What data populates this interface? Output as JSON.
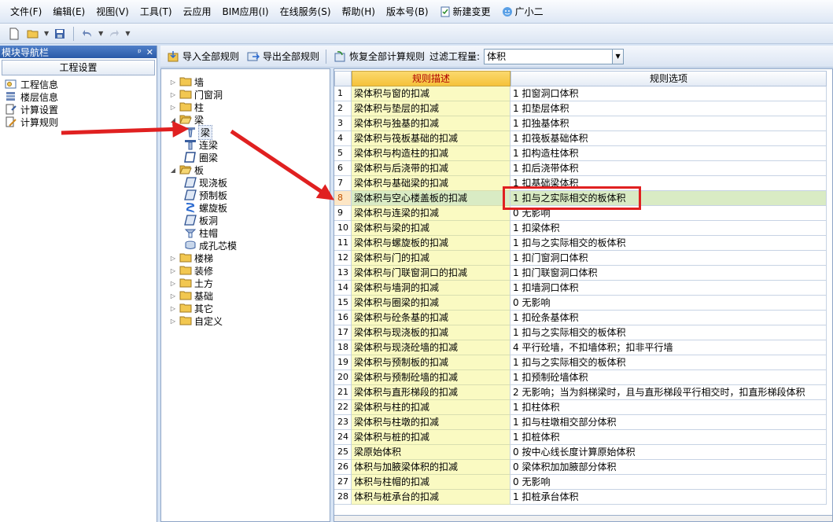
{
  "menu": {
    "items": [
      "文件(F)",
      "编辑(E)",
      "视图(V)",
      "工具(T)",
      "云应用",
      "BIM应用(I)",
      "在线服务(S)",
      "帮助(H)",
      "版本号(B)"
    ],
    "new_change": "新建变更",
    "assistant": "广小二"
  },
  "nav": {
    "title": "模块导航栏",
    "pin_icon": "ᵖ",
    "close_icon": "✕",
    "header": "工程设置",
    "items": [
      "工程信息",
      "楼层信息",
      "计算设置",
      "计算规则"
    ]
  },
  "right_toolbar": {
    "import_label": "导入全部规则",
    "export_label": "导出全部规则",
    "restore_label": "恢复全部计算规则",
    "filter_label": "过滤工程量:",
    "filter_value": "体积"
  },
  "tree": {
    "items": [
      {
        "label": "墙",
        "toggle": "▷",
        "kind": "folder"
      },
      {
        "label": "门窗洞",
        "toggle": "▷",
        "kind": "folder"
      },
      {
        "label": "柱",
        "toggle": "▷",
        "kind": "folder"
      },
      {
        "label": "梁",
        "toggle": "◢",
        "kind": "folder-open"
      },
      {
        "label": "梁",
        "toggle": "",
        "kind": "beam",
        "selected": true
      },
      {
        "label": "连梁",
        "toggle": "",
        "kind": "beam2"
      },
      {
        "label": "圈梁",
        "toggle": "",
        "kind": "ring"
      },
      {
        "label": "板",
        "toggle": "◢",
        "kind": "folder-open"
      },
      {
        "label": "现浇板",
        "toggle": "",
        "kind": "slab"
      },
      {
        "label": "预制板",
        "toggle": "",
        "kind": "slab"
      },
      {
        "label": "螺旋板",
        "toggle": "",
        "kind": "spiral"
      },
      {
        "label": "板洞",
        "toggle": "",
        "kind": "slab"
      },
      {
        "label": "柱帽",
        "toggle": "",
        "kind": "cap"
      },
      {
        "label": "成孔芯模",
        "toggle": "",
        "kind": "core"
      },
      {
        "label": "楼梯",
        "toggle": "▷",
        "kind": "folder"
      },
      {
        "label": "装修",
        "toggle": "▷",
        "kind": "folder"
      },
      {
        "label": "土方",
        "toggle": "▷",
        "kind": "folder"
      },
      {
        "label": "基础",
        "toggle": "▷",
        "kind": "folder"
      },
      {
        "label": "其它",
        "toggle": "▷",
        "kind": "folder"
      },
      {
        "label": "自定义",
        "toggle": "▷",
        "kind": "folder"
      }
    ]
  },
  "grid": {
    "col_desc": "规则描述",
    "col_opt": "规则选项",
    "active_row": 8,
    "rows": [
      {
        "num": "1",
        "desc": "梁体积与窗的扣减",
        "opt": "1 扣窗洞口体积"
      },
      {
        "num": "2",
        "desc": "梁体积与垫层的扣减",
        "opt": "1 扣垫层体积"
      },
      {
        "num": "3",
        "desc": "梁体积与独基的扣减",
        "opt": "1 扣独基体积"
      },
      {
        "num": "4",
        "desc": "梁体积与筏板基础的扣减",
        "opt": "1 扣筏板基础体积"
      },
      {
        "num": "5",
        "desc": "梁体积与构造柱的扣减",
        "opt": "1 扣构造柱体积"
      },
      {
        "num": "6",
        "desc": "梁体积与后浇带的扣减",
        "opt": "1 扣后浇带体积"
      },
      {
        "num": "7",
        "desc": "梁体积与基础梁的扣减",
        "opt": "1 扣基础梁体积"
      },
      {
        "num": "8",
        "desc": "梁体积与空心楼盖板的扣减",
        "opt": "1 扣与之实际相交的板体积"
      },
      {
        "num": "9",
        "desc": "梁体积与连梁的扣减",
        "opt": "0  无影响"
      },
      {
        "num": "10",
        "desc": "梁体积与梁的扣减",
        "opt": "1 扣梁体积"
      },
      {
        "num": "11",
        "desc": "梁体积与螺旋板的扣减",
        "opt": "1 扣与之实际相交的板体积"
      },
      {
        "num": "12",
        "desc": "梁体积与门的扣减",
        "opt": "1 扣门窗洞口体积"
      },
      {
        "num": "13",
        "desc": "梁体积与门联窗洞口的扣减",
        "opt": "1 扣门联窗洞口体积"
      },
      {
        "num": "14",
        "desc": "梁体积与墙洞的扣减",
        "opt": "1 扣墙洞口体积"
      },
      {
        "num": "15",
        "desc": "梁体积与圈梁的扣减",
        "opt": "0  无影响"
      },
      {
        "num": "16",
        "desc": "梁体积与砼条基的扣减",
        "opt": "1 扣砼条基体积"
      },
      {
        "num": "17",
        "desc": "梁体积与现浇板的扣减",
        "opt": "1 扣与之实际相交的板体积"
      },
      {
        "num": "18",
        "desc": "梁体积与现浇砼墙的扣减",
        "opt": "4 平行砼墙，不扣墙体积；扣非平行墙"
      },
      {
        "num": "19",
        "desc": "梁体积与预制板的扣减",
        "opt": "1 扣与之实际相交的板体积"
      },
      {
        "num": "20",
        "desc": "梁体积与预制砼墙的扣减",
        "opt": "1  扣预制砼墙体积"
      },
      {
        "num": "21",
        "desc": "梁体积与直形梯段的扣减",
        "opt": "2 无影响；当为斜梯梁时，且与直形梯段平行相交时，扣直形梯段体积"
      },
      {
        "num": "22",
        "desc": "梁体积与柱的扣减",
        "opt": "1 扣柱体积"
      },
      {
        "num": "23",
        "desc": "梁体积与柱墩的扣减",
        "opt": "1 扣与柱墩相交部分体积"
      },
      {
        "num": "24",
        "desc": "梁体积与桩的扣减",
        "opt": "1 扣桩体积"
      },
      {
        "num": "25",
        "desc": "梁原始体积",
        "opt": "0 按中心线长度计算原始体积"
      },
      {
        "num": "26",
        "desc": "体积与加腋梁体积的扣减",
        "opt": "0 梁体积加加腋部分体积"
      },
      {
        "num": "27",
        "desc": "体积与柱帽的扣减",
        "opt": "0  无影响"
      },
      {
        "num": "28",
        "desc": "体积与桩承台的扣减",
        "opt": "1 扣桩承台体积"
      }
    ]
  },
  "colors": {
    "annotation_red": "#e02020",
    "header_gold": "#f5c23a",
    "desc_yellow": "#fafac2",
    "active_green": "#d9ebc4"
  }
}
